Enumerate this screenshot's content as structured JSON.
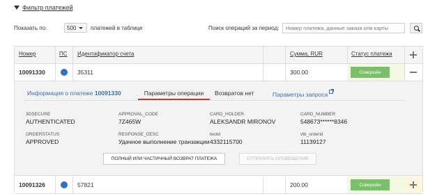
{
  "filter": {
    "label": "Фильтр платежей"
  },
  "toolbar": {
    "show_label": "Показать по:",
    "per_page": "500",
    "rows_label": "платежей в таблице",
    "period_label": "Поиск операций за период:",
    "search_placeholder": "Номер платежа, данные заказа или карты"
  },
  "table": {
    "headers": {
      "number": "Номер",
      "ps": "ПС",
      "account": "Идентификатор счета",
      "amount": "Сумма, RUR",
      "status": "Статус платежа"
    },
    "rows": [
      {
        "number": "10091330",
        "account": "35311",
        "amount": "300.00",
        "status": "Совершён",
        "ps_color": "#2d73c9"
      },
      {
        "number": "10091326",
        "account": "57821",
        "amount": "200.00",
        "status": "Совершён",
        "ps_color": "#2d73c9"
      }
    ]
  },
  "details": {
    "tabs": {
      "info_prefix": "Информация о платеже",
      "info_number": "10091330",
      "params": "Параметры операции",
      "refunds": "Возвратов нет",
      "request": "Параметры запроса"
    },
    "params": [
      {
        "label": "3DSECURE",
        "value": "AUTHENTICATED"
      },
      {
        "label": "APPROVAL_CODE",
        "value": "7Z465W"
      },
      {
        "label": "CARD_HOLDER",
        "value": "ALEKSANDR MIRONOV"
      },
      {
        "label": "CARD_NUMBER",
        "value": "548673******8346"
      },
      {
        "label": "ORDERSTATUS",
        "value": "APPROVED"
      },
      {
        "label": "RESPONSE_DESC",
        "value": "Удачное выполнение транзакции"
      },
      {
        "label": "twold",
        "value": "4332115700"
      },
      {
        "label": "vtb_orderid",
        "value": "11139127"
      }
    ],
    "buttons": {
      "refund": "ПОЛНЫЙ ИЛИ ЧАСТИЧНЫЙ ВОЗВРАТ ПЛАТЕЖА",
      "notify": "ОТПРАВИТЬ ОПОВЕЩЕНИЕ"
    }
  }
}
